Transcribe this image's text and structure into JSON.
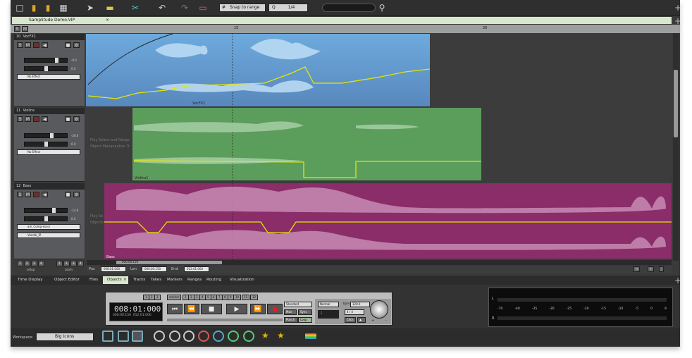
{
  "toolbar": {
    "snap_label": "Snap to range",
    "quant_label": "Q",
    "quant_value": "1/4",
    "search_placeholder": ""
  },
  "tab": {
    "title": "Samplitude Demo.VIP",
    "close": "×"
  },
  "ruler": {
    "left_marker": "S",
    "s_btn": "S",
    "m_btn": "M",
    "mark_15": "15",
    "mark_20": "20"
  },
  "tracks": [
    {
      "num": "10",
      "name": "VocFX1",
      "vol": "-9.0",
      "pan": "0.0",
      "fx": "No Effect",
      "obj_label": "VocFX1",
      "color": "#6ea1d2"
    },
    {
      "num": "11",
      "name": "Violins",
      "vol": "-20.6",
      "pan": "0.0",
      "fx": "No Effect",
      "obj_label": "Violins1",
      "color": "#5aa15a",
      "hint1": "Play Select and Range",
      "hint2": "Object Manipulation Tr"
    },
    {
      "num": "12",
      "name": "Bass",
      "vol": "-14.8",
      "pan": "0.0",
      "fx1": "am_Compressor",
      "fx2": "Vandal_IR",
      "obj_label": "Bass",
      "color": "#8d2d6b",
      "hint1": "Play Se",
      "hint2": "Objects"
    }
  ],
  "track_btn": {
    "s": "S",
    "m": "M"
  },
  "setup": {
    "label": "setup",
    "zoom": "zoom",
    "nums": [
      "1",
      "2",
      "3",
      "4"
    ]
  },
  "position": {
    "pos_label": "Pos",
    "pos": "008:01:000",
    "len_label": "Len",
    "len": "000:00:150",
    "end_label": "End",
    "end": "012:01:000",
    "marker_time": "000:00:150"
  },
  "tabs": [
    "Time Display",
    "Object Editor",
    "Files",
    "Objects",
    "Tracks",
    "Takes",
    "Markers",
    "Ranges",
    "Routing",
    "Visualization"
  ],
  "active_tab_close": "×",
  "transport": {
    "time": "008:01:000",
    "sub_left": "000:00:150",
    "sub_right": "012:01:000",
    "marker_label": "marker",
    "marker_nums": [
      "1",
      "2",
      "3",
      "4",
      "5",
      "6",
      "7",
      "8",
      "9",
      "10",
      "11",
      "12"
    ],
    "pre": [
      "1",
      "2",
      "3"
    ],
    "standard": "Standard",
    "mon": "Mon",
    "sync": "Sync",
    "punch": "Punch",
    "loop": "Loop",
    "normal": "Normal",
    "bpm_label": "bpm",
    "bpm": "120.0",
    "sig": "4 / 4",
    "click": "Click",
    "plus": "+",
    "minus": "-",
    "keys": [
      "⏮",
      "⏪",
      "■",
      "▶",
      "⏩",
      "●"
    ]
  },
  "meter": {
    "top_l": "L",
    "bot_l": "R",
    "scale": [
      "-70",
      "-40",
      "-35",
      "-30",
      "-25",
      "-20",
      "-15",
      "-10",
      "-5",
      "0",
      "9"
    ]
  },
  "workspace": {
    "label": "Workspace:",
    "value": "Big Icons"
  },
  "colors": {
    "accent": "#d8e6cc",
    "envelope": "#e6e600"
  }
}
